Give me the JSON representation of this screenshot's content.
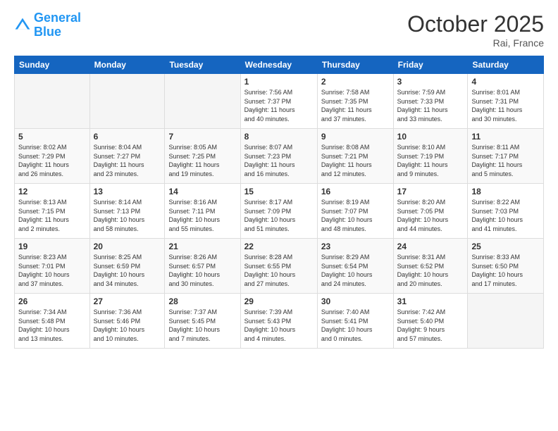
{
  "logo": {
    "line1": "General",
    "line2": "Blue"
  },
  "title": "October 2025",
  "location": "Rai, France",
  "days_header": [
    "Sunday",
    "Monday",
    "Tuesday",
    "Wednesday",
    "Thursday",
    "Friday",
    "Saturday"
  ],
  "weeks": [
    [
      {
        "num": "",
        "info": ""
      },
      {
        "num": "",
        "info": ""
      },
      {
        "num": "",
        "info": ""
      },
      {
        "num": "1",
        "info": "Sunrise: 7:56 AM\nSunset: 7:37 PM\nDaylight: 11 hours\nand 40 minutes."
      },
      {
        "num": "2",
        "info": "Sunrise: 7:58 AM\nSunset: 7:35 PM\nDaylight: 11 hours\nand 37 minutes."
      },
      {
        "num": "3",
        "info": "Sunrise: 7:59 AM\nSunset: 7:33 PM\nDaylight: 11 hours\nand 33 minutes."
      },
      {
        "num": "4",
        "info": "Sunrise: 8:01 AM\nSunset: 7:31 PM\nDaylight: 11 hours\nand 30 minutes."
      }
    ],
    [
      {
        "num": "5",
        "info": "Sunrise: 8:02 AM\nSunset: 7:29 PM\nDaylight: 11 hours\nand 26 minutes."
      },
      {
        "num": "6",
        "info": "Sunrise: 8:04 AM\nSunset: 7:27 PM\nDaylight: 11 hours\nand 23 minutes."
      },
      {
        "num": "7",
        "info": "Sunrise: 8:05 AM\nSunset: 7:25 PM\nDaylight: 11 hours\nand 19 minutes."
      },
      {
        "num": "8",
        "info": "Sunrise: 8:07 AM\nSunset: 7:23 PM\nDaylight: 11 hours\nand 16 minutes."
      },
      {
        "num": "9",
        "info": "Sunrise: 8:08 AM\nSunset: 7:21 PM\nDaylight: 11 hours\nand 12 minutes."
      },
      {
        "num": "10",
        "info": "Sunrise: 8:10 AM\nSunset: 7:19 PM\nDaylight: 11 hours\nand 9 minutes."
      },
      {
        "num": "11",
        "info": "Sunrise: 8:11 AM\nSunset: 7:17 PM\nDaylight: 11 hours\nand 5 minutes."
      }
    ],
    [
      {
        "num": "12",
        "info": "Sunrise: 8:13 AM\nSunset: 7:15 PM\nDaylight: 11 hours\nand 2 minutes."
      },
      {
        "num": "13",
        "info": "Sunrise: 8:14 AM\nSunset: 7:13 PM\nDaylight: 10 hours\nand 58 minutes."
      },
      {
        "num": "14",
        "info": "Sunrise: 8:16 AM\nSunset: 7:11 PM\nDaylight: 10 hours\nand 55 minutes."
      },
      {
        "num": "15",
        "info": "Sunrise: 8:17 AM\nSunset: 7:09 PM\nDaylight: 10 hours\nand 51 minutes."
      },
      {
        "num": "16",
        "info": "Sunrise: 8:19 AM\nSunset: 7:07 PM\nDaylight: 10 hours\nand 48 minutes."
      },
      {
        "num": "17",
        "info": "Sunrise: 8:20 AM\nSunset: 7:05 PM\nDaylight: 10 hours\nand 44 minutes."
      },
      {
        "num": "18",
        "info": "Sunrise: 8:22 AM\nSunset: 7:03 PM\nDaylight: 10 hours\nand 41 minutes."
      }
    ],
    [
      {
        "num": "19",
        "info": "Sunrise: 8:23 AM\nSunset: 7:01 PM\nDaylight: 10 hours\nand 37 minutes."
      },
      {
        "num": "20",
        "info": "Sunrise: 8:25 AM\nSunset: 6:59 PM\nDaylight: 10 hours\nand 34 minutes."
      },
      {
        "num": "21",
        "info": "Sunrise: 8:26 AM\nSunset: 6:57 PM\nDaylight: 10 hours\nand 30 minutes."
      },
      {
        "num": "22",
        "info": "Sunrise: 8:28 AM\nSunset: 6:55 PM\nDaylight: 10 hours\nand 27 minutes."
      },
      {
        "num": "23",
        "info": "Sunrise: 8:29 AM\nSunset: 6:54 PM\nDaylight: 10 hours\nand 24 minutes."
      },
      {
        "num": "24",
        "info": "Sunrise: 8:31 AM\nSunset: 6:52 PM\nDaylight: 10 hours\nand 20 minutes."
      },
      {
        "num": "25",
        "info": "Sunrise: 8:33 AM\nSunset: 6:50 PM\nDaylight: 10 hours\nand 17 minutes."
      }
    ],
    [
      {
        "num": "26",
        "info": "Sunrise: 7:34 AM\nSunset: 5:48 PM\nDaylight: 10 hours\nand 13 minutes."
      },
      {
        "num": "27",
        "info": "Sunrise: 7:36 AM\nSunset: 5:46 PM\nDaylight: 10 hours\nand 10 minutes."
      },
      {
        "num": "28",
        "info": "Sunrise: 7:37 AM\nSunset: 5:45 PM\nDaylight: 10 hours\nand 7 minutes."
      },
      {
        "num": "29",
        "info": "Sunrise: 7:39 AM\nSunset: 5:43 PM\nDaylight: 10 hours\nand 4 minutes."
      },
      {
        "num": "30",
        "info": "Sunrise: 7:40 AM\nSunset: 5:41 PM\nDaylight: 10 hours\nand 0 minutes."
      },
      {
        "num": "31",
        "info": "Sunrise: 7:42 AM\nSunset: 5:40 PM\nDaylight: 9 hours\nand 57 minutes."
      },
      {
        "num": "",
        "info": ""
      }
    ]
  ]
}
